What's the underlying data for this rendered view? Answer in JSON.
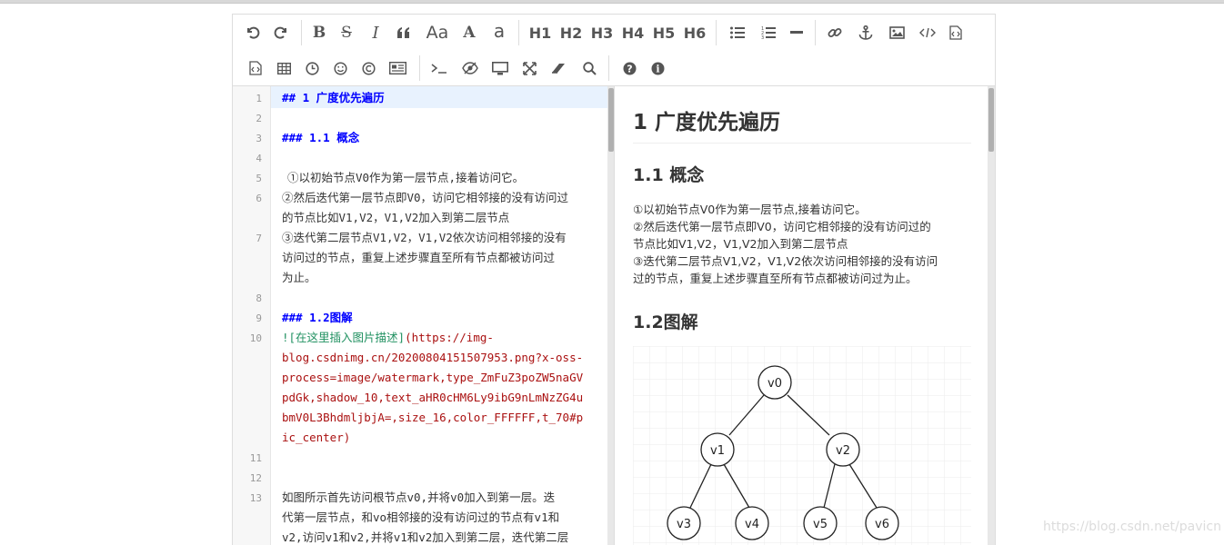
{
  "toolbar": {
    "undo_icon": "undo-icon",
    "redo_icon": "redo-icon",
    "bold_label": "B",
    "strike_label": "S",
    "italic_label": "I",
    "quote_icon": "quote-icon",
    "uppercase_label": "Aa",
    "size_up_label": "A",
    "lowercase_label": "a",
    "h1": "H1",
    "h2": "H2",
    "h3": "H3",
    "h4": "H4",
    "h5": "H5",
    "h6": "H6",
    "icons": [
      "list-ul-icon",
      "list-ol-icon",
      "hr-icon",
      "link-icon",
      "anchor-icon",
      "image-icon",
      "code-icon",
      "code-block-icon",
      "preformatted-icon",
      "table-icon",
      "datetime-icon",
      "emoji-icon",
      "html-entities-icon",
      "pagebreak-icon",
      "terminal-icon",
      "watch-icon",
      "preview-icon",
      "fullscreen-icon",
      "clear-icon",
      "search-icon",
      "help-icon",
      "info-icon"
    ]
  },
  "editor": {
    "lines": [
      {
        "n": "1",
        "text": "## 1 广度优先遍历"
      },
      {
        "n": "2",
        "text": ""
      },
      {
        "n": "3",
        "text": "### 1.1 概念"
      },
      {
        "n": "4",
        "text": ""
      },
      {
        "n": "5",
        "text": "①以初始节点V0作为第一层节点,接着访问它。"
      },
      {
        "n": "6",
        "text": "②然后迭代第一层节点即V0，访问它相邻接的没有访问过",
        "cont": "的节点比如V1,V2，V1,V2加入到第二层节点"
      },
      {
        "n": "7",
        "text": "③迭代第二层节点V1,V2，V1,V2依次访问相邻接的没有",
        "cont": "访问过的节点，重复上述步骤直至所有节点都被访问过",
        "cont2": "为止。"
      },
      {
        "n": "8",
        "text": ""
      },
      {
        "n": "9",
        "text": "### 1.2图解"
      },
      {
        "n": "10",
        "link_text": "![在这里插入图片描述]",
        "url1": "(https://img-",
        "url2": "blog.csdnimg.cn/20200804151507953.png?x-oss-",
        "url3": "process=image/watermark,type_ZmFuZ3poZW5naGV",
        "url4": "pdGk,shadow_10,text_aHR0cHM6Ly9ibG9nLmNzZG4u",
        "url5": "bmV0L3BhdmljbjA=,size_16,color_FFFFFF,t_70#p",
        "url6": "ic_center)"
      },
      {
        "n": "11",
        "text": ""
      },
      {
        "n": "12",
        "text": ""
      },
      {
        "n": "13",
        "text": "如图所示首先访问根节点v0,并将v0加入到第一层。迭",
        "cont": "代第一层节点，和vo相邻接的没有访问过的节点有v1和",
        "cont2": "v2,访问v1和v2,并将v1和v2加入到第二层，迭代第二层"
      }
    ]
  },
  "preview": {
    "h1": "1 广度优先遍历",
    "h2a": "1.1 概念",
    "p1": "①以初始节点V0作为第一层节点,接着访问它。",
    "p2": "②然后迭代第一层节点即V0，访问它相邻接的没有访问过的",
    "p2b": "节点比如V1,V2，V1,V2加入到第二层节点",
    "p3": "③迭代第二层节点V1,V2，V1,V2依次访问相邻接的没有访问",
    "p3b": "过的节点，重复上述步骤直至所有节点都被访问过为止。",
    "h2b": "1.2图解",
    "nodes": [
      "v0",
      "v1",
      "v2",
      "v3",
      "v4",
      "v5",
      "v6"
    ]
  },
  "watermark": "https://blog.csdn.net/pavicn"
}
